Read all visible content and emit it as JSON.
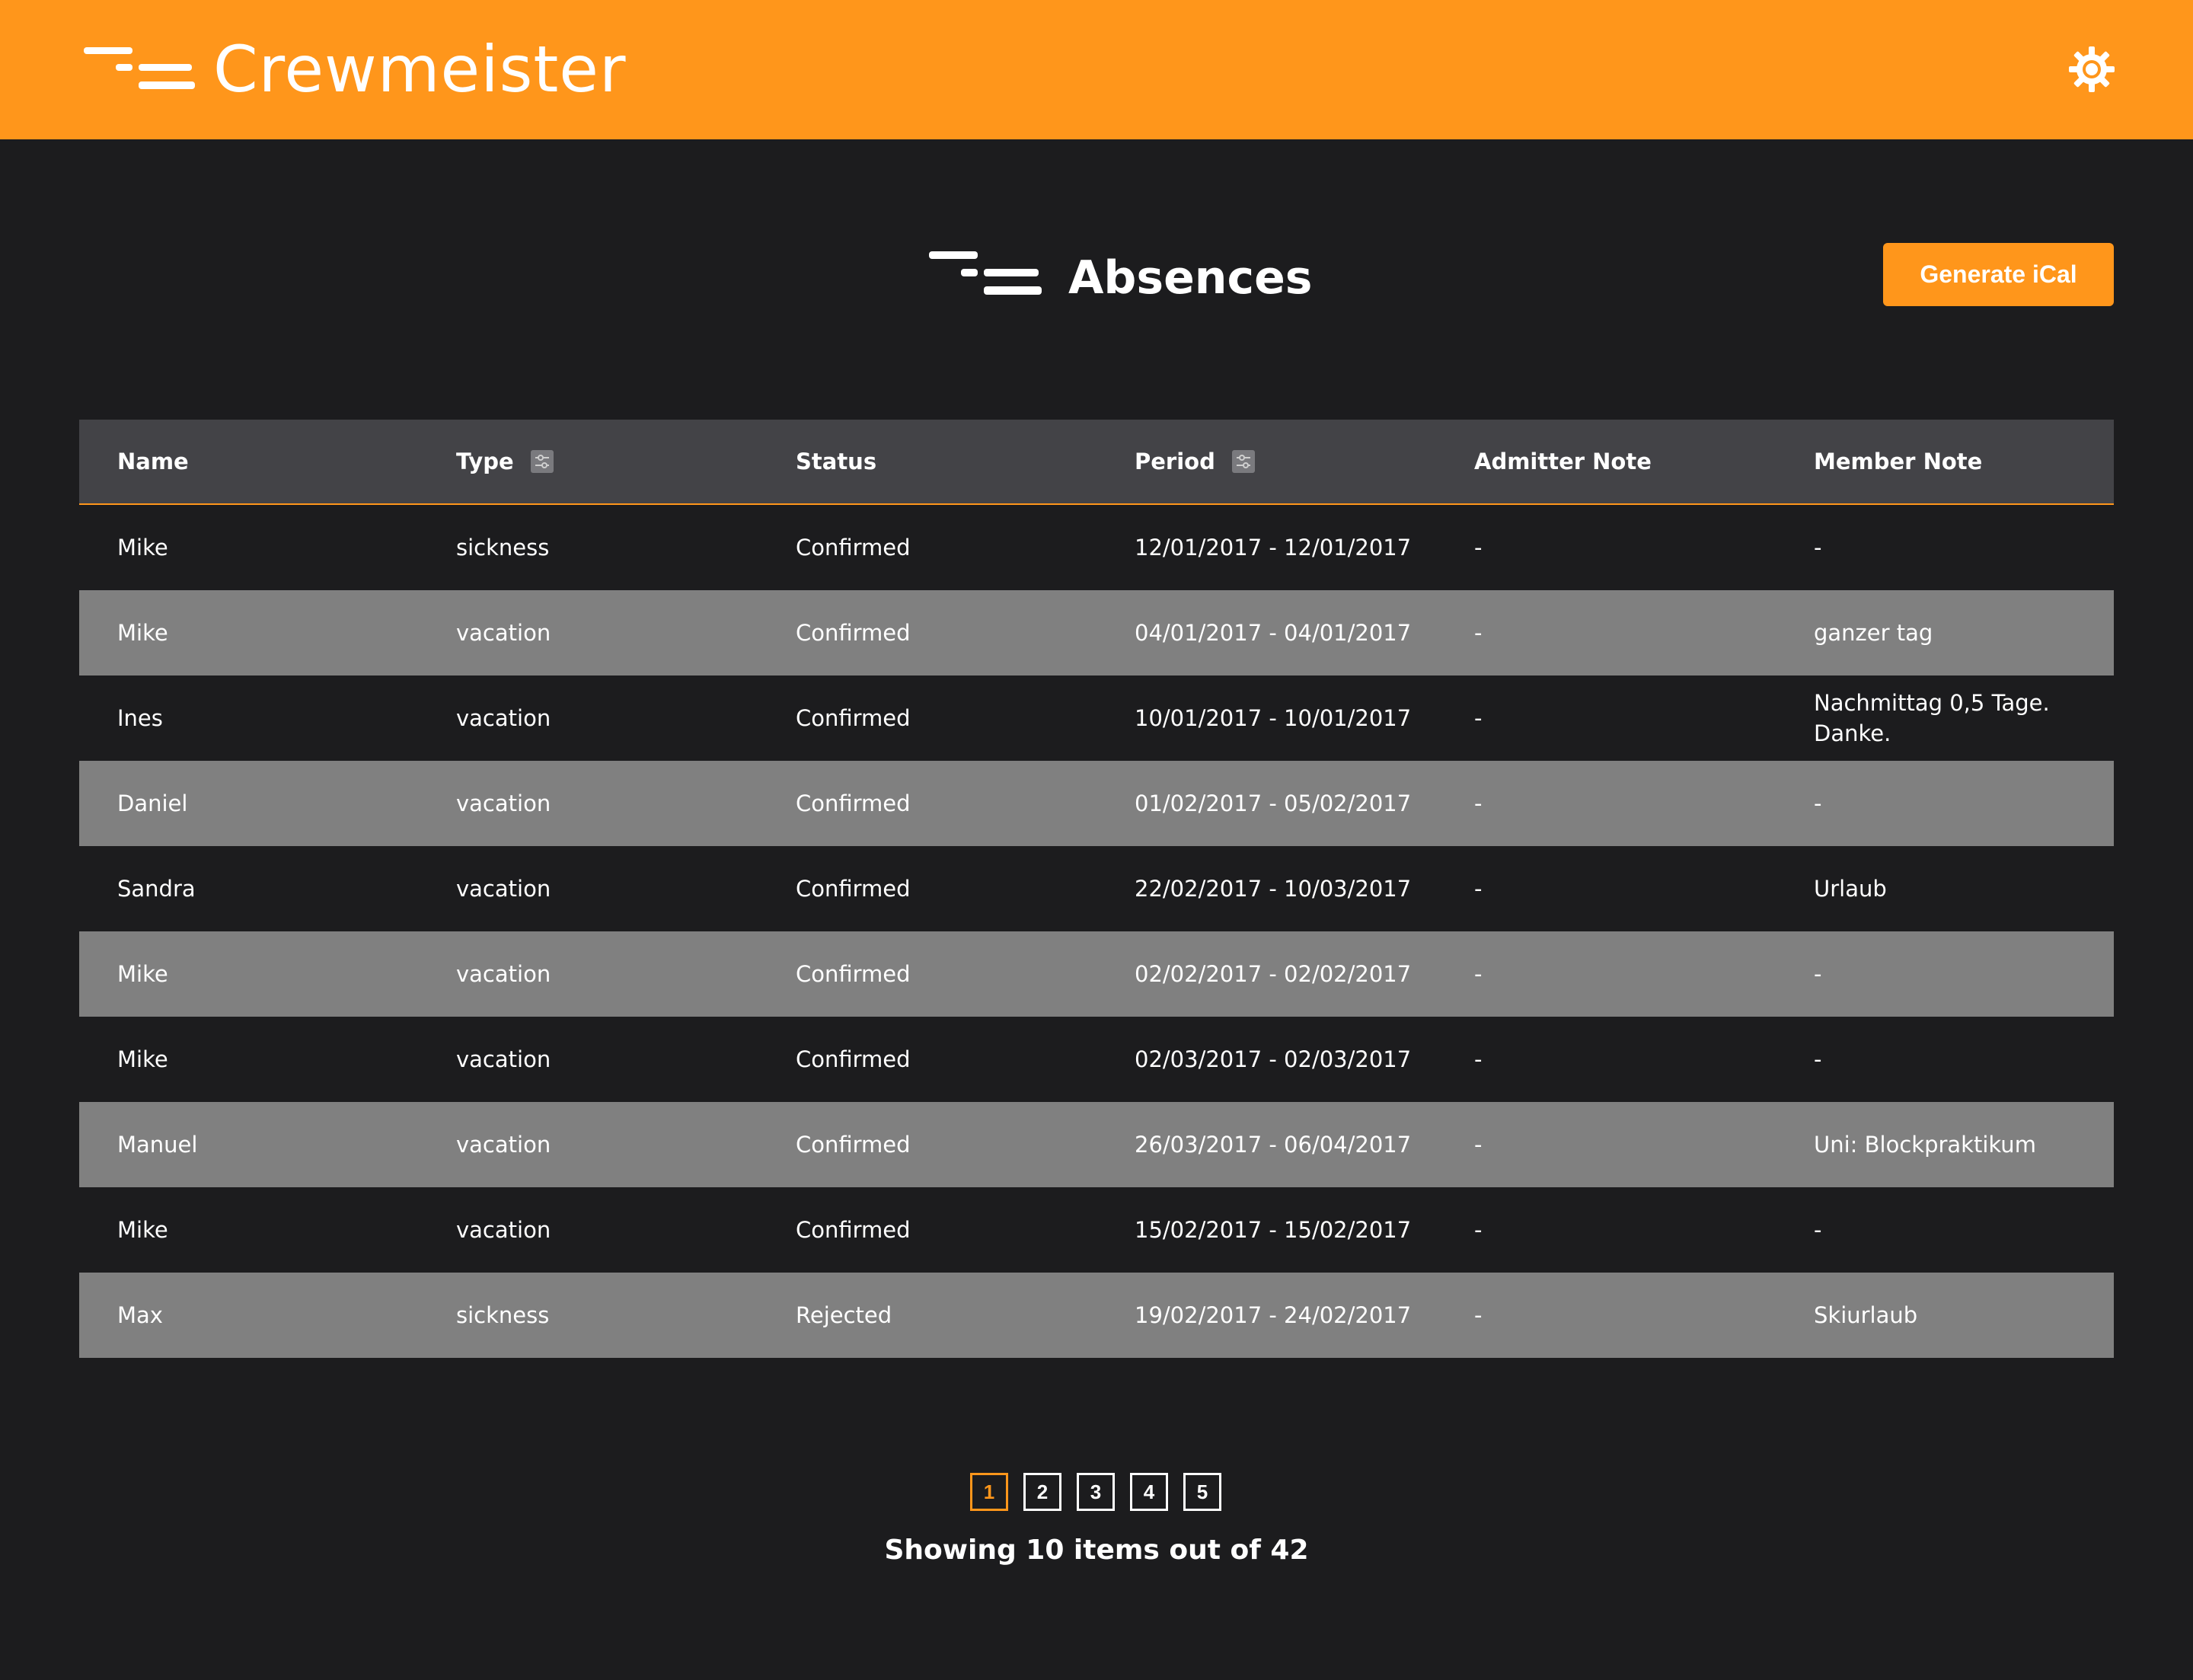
{
  "header": {
    "brand_name": "Crewmeister",
    "accent_color": "#ff961b",
    "logo_icon": "crewmeister-logo-icon",
    "settings_icon": "gear-icon"
  },
  "page": {
    "title": "Absences",
    "title_icon": "crewmeister-logo-icon",
    "ical_button_label": "Generate iCal"
  },
  "table": {
    "columns": [
      {
        "label": "Name",
        "sortable": false
      },
      {
        "label": "Type",
        "sortable": true
      },
      {
        "label": "Status",
        "sortable": false
      },
      {
        "label": "Period",
        "sortable": true
      },
      {
        "label": "Admitter Note",
        "sortable": false
      },
      {
        "label": "Member Note",
        "sortable": false
      }
    ],
    "rows": [
      {
        "name": "Mike",
        "type": "sickness",
        "status": "Confirmed",
        "period": "12/01/2017 - 12/01/2017",
        "admitter_note": "-",
        "member_note": "-"
      },
      {
        "name": "Mike",
        "type": "vacation",
        "status": "Confirmed",
        "period": "04/01/2017 - 04/01/2017",
        "admitter_note": "-",
        "member_note": "ganzer tag"
      },
      {
        "name": "Ines",
        "type": "vacation",
        "status": "Confirmed",
        "period": "10/01/2017 - 10/01/2017",
        "admitter_note": "-",
        "member_note": "Nachmittag 0,5 Tage. Danke."
      },
      {
        "name": "Daniel",
        "type": "vacation",
        "status": "Confirmed",
        "period": "01/02/2017 - 05/02/2017",
        "admitter_note": "-",
        "member_note": "-"
      },
      {
        "name": "Sandra",
        "type": "vacation",
        "status": "Confirmed",
        "period": "22/02/2017 - 10/03/2017",
        "admitter_note": "-",
        "member_note": "Urlaub"
      },
      {
        "name": "Mike",
        "type": "vacation",
        "status": "Confirmed",
        "period": "02/02/2017 - 02/02/2017",
        "admitter_note": "-",
        "member_note": "-"
      },
      {
        "name": "Mike",
        "type": "vacation",
        "status": "Confirmed",
        "period": "02/03/2017 - 02/03/2017",
        "admitter_note": "-",
        "member_note": "-"
      },
      {
        "name": "Manuel",
        "type": "vacation",
        "status": "Confirmed",
        "period": "26/03/2017 - 06/04/2017",
        "admitter_note": "-",
        "member_note": "Uni: Blockpraktikum"
      },
      {
        "name": "Mike",
        "type": "vacation",
        "status": "Confirmed",
        "period": "15/02/2017 - 15/02/2017",
        "admitter_note": "-",
        "member_note": "-"
      },
      {
        "name": "Max",
        "type": "sickness",
        "status": "Rejected",
        "period": "19/02/2017 - 24/02/2017",
        "admitter_note": "-",
        "member_note": "Skiurlaub"
      }
    ]
  },
  "pagination": {
    "pages": [
      "1",
      "2",
      "3",
      "4",
      "5"
    ],
    "current": "1",
    "summary": "Showing 10 items out of 42"
  }
}
